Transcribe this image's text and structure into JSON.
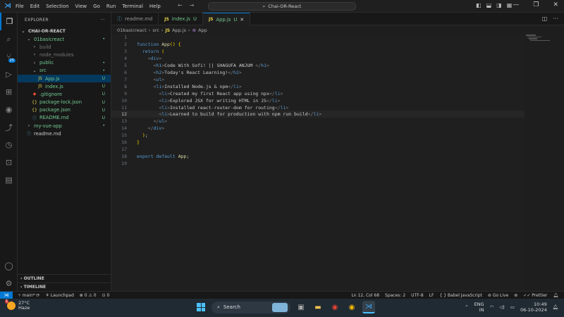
{
  "titlebar": {
    "menu": [
      "File",
      "Edit",
      "Selection",
      "View",
      "Go",
      "Run",
      "Terminal",
      "Help"
    ],
    "search": "Chai-OR-React"
  },
  "sidebar": {
    "title": "EXPLORER",
    "more": "···",
    "root": "CHAI-OR-REACT",
    "items": [
      {
        "label": "01basicreact",
        "indent": 1,
        "kind": "folder-open",
        "status": "•",
        "cls": "green"
      },
      {
        "label": "build",
        "indent": 2,
        "kind": "folder",
        "status": "",
        "cls": "dim"
      },
      {
        "label": "node_modules",
        "indent": 2,
        "kind": "folder",
        "status": "",
        "cls": "dim"
      },
      {
        "label": "public",
        "indent": 2,
        "kind": "folder",
        "status": "•",
        "cls": "green"
      },
      {
        "label": "src",
        "indent": 2,
        "kind": "folder-open",
        "status": "•",
        "cls": "green"
      },
      {
        "label": "App.js",
        "indent": 3,
        "kind": "js",
        "status": "U",
        "cls": "green",
        "selected": true
      },
      {
        "label": "index.js",
        "indent": 3,
        "kind": "js",
        "status": "U",
        "cls": "green"
      },
      {
        "label": ".gitignore",
        "indent": 2,
        "kind": "git",
        "status": "U",
        "cls": "green"
      },
      {
        "label": "package-lock.json",
        "indent": 2,
        "kind": "json",
        "status": "U",
        "cls": "green"
      },
      {
        "label": "package.json",
        "indent": 2,
        "kind": "json",
        "status": "U",
        "cls": "green"
      },
      {
        "label": "README.md",
        "indent": 2,
        "kind": "info",
        "status": "U",
        "cls": "green"
      },
      {
        "label": "my-vue-app",
        "indent": 1,
        "kind": "folder",
        "status": "•",
        "cls": "green"
      },
      {
        "label": "readme.md",
        "indent": 1,
        "kind": "md",
        "status": "",
        "cls": ""
      }
    ],
    "outline": "OUTLINE",
    "timeline": "TIMELINE"
  },
  "tabs": [
    {
      "label": "readme.md",
      "icon": "ⓘ",
      "status": "",
      "active": false
    },
    {
      "label": "index.js",
      "icon": "JS",
      "status": "U",
      "active": false
    },
    {
      "label": "App.js",
      "icon": "JS",
      "status": "U",
      "active": true
    }
  ],
  "breadcrumb": [
    "01basicreact",
    "src",
    "App.js",
    "App"
  ],
  "code_lines": [
    "",
    "function App() {",
    "  return (",
    "    <div>",
    "      <h1>Code With Sofi! || SHAGUFA ANJUM </h1>",
    "      <h2>Today's React Learning!</h2>",
    "      <ul>",
    "      <li>Installed Node.js & npm</li>",
    "        <li>Created my first React app using npx</li>",
    "        <li>Explored JSX for writing HTML in JS</li>",
    "        <li>Installed react-router-dom for routing</li>",
    "        <li>Learned to build for production with npm run build</li>",
    "      </ul>",
    "    </div>",
    "  );",
    "}",
    "",
    "export default App;",
    ""
  ],
  "current_line": 12,
  "status": {
    "branch": "main*",
    "launchpad": "Launchpad",
    "errors": "0",
    "warnings": "0",
    "ports": "0",
    "cursor": "Ln 12, Col 68",
    "spaces": "Spaces: 2",
    "encoding": "UTF-8",
    "eol": "LF",
    "language": "Babel JavaScript",
    "golive": "Go Live",
    "prettier": "Prettier"
  },
  "taskbar": {
    "temp": "27°C",
    "weather": "Haze",
    "notif": "1",
    "search": "Search",
    "lang1": "ENG",
    "lang2": "IN",
    "time": "10:49",
    "date": "06-10-2024"
  }
}
